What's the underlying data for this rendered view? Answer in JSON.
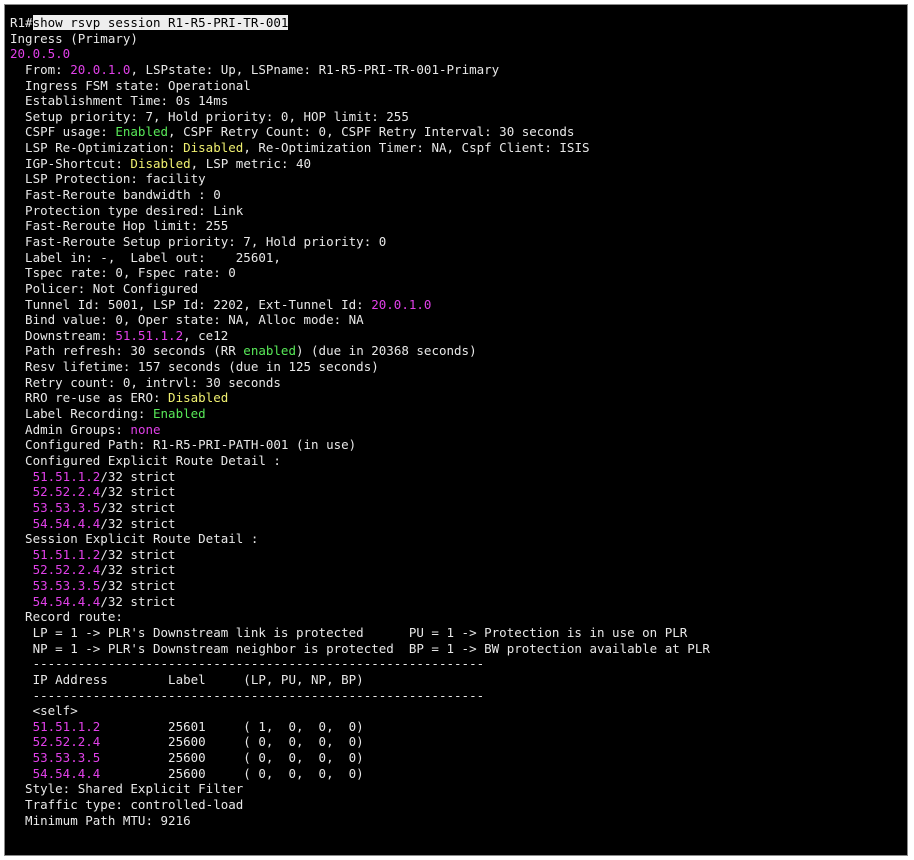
{
  "theme": {
    "background": "#000000",
    "default": "#e8e8e8",
    "magenta": "#e040e8",
    "green": "#58e858",
    "yellow": "#f0f070",
    "highlight_bg": "#eeeeee",
    "highlight_fg": "#000000"
  },
  "terminal": {
    "lines": [
      [
        {
          "t": "R1#",
          "c": "w"
        },
        {
          "t": "show rsvp session R1-R5-PRI-TR-001",
          "c": "cmd"
        }
      ],
      [
        {
          "t": "Ingress (Primary)",
          "c": "w"
        }
      ],
      [
        {
          "t": "20.0.5.0",
          "c": "m"
        }
      ],
      [
        {
          "t": "  From: ",
          "c": "w"
        },
        {
          "t": "20.0.1.0",
          "c": "m"
        },
        {
          "t": ", LSPstate: Up, LSPname: R1-R5-PRI-TR-001-Primary",
          "c": "w"
        }
      ],
      [
        {
          "t": "  Ingress FSM state: Operational",
          "c": "w"
        }
      ],
      [
        {
          "t": "  Establishment Time: 0s 14ms",
          "c": "w"
        }
      ],
      [
        {
          "t": "  Setup priority: 7, Hold priority: 0, HOP limit: 255",
          "c": "w"
        }
      ],
      [
        {
          "t": "  CSPF usage: ",
          "c": "w"
        },
        {
          "t": "Enabled",
          "c": "g"
        },
        {
          "t": ", CSPF Retry Count: 0, CSPF Retry Interval: 30 seconds",
          "c": "w"
        }
      ],
      [
        {
          "t": "  LSP Re-Optimization: ",
          "c": "w"
        },
        {
          "t": "Disabled",
          "c": "y"
        },
        {
          "t": ", Re-Optimization Timer: NA, Cspf Client: ISIS",
          "c": "w"
        }
      ],
      [
        {
          "t": "  IGP-Shortcut: ",
          "c": "w"
        },
        {
          "t": "Disabled",
          "c": "y"
        },
        {
          "t": ", LSP metric: 40",
          "c": "w"
        }
      ],
      [
        {
          "t": "  LSP Protection: facility",
          "c": "w"
        }
      ],
      [
        {
          "t": "  Fast-Reroute bandwidth : 0",
          "c": "w"
        }
      ],
      [
        {
          "t": "  Protection type desired: Link",
          "c": "w"
        }
      ],
      [
        {
          "t": "  Fast-Reroute Hop limit: 255",
          "c": "w"
        }
      ],
      [
        {
          "t": "  Fast-Reroute Setup priority: 7, Hold priority: 0",
          "c": "w"
        }
      ],
      [
        {
          "t": "  Label in: -,  Label out:    25601,",
          "c": "w"
        }
      ],
      [
        {
          "t": "  Tspec rate: 0, Fspec rate: 0",
          "c": "w"
        }
      ],
      [
        {
          "t": "  Policer: Not Configured",
          "c": "w"
        }
      ],
      [
        {
          "t": "  Tunnel Id: 5001, LSP Id: 2202, Ext-Tunnel Id: ",
          "c": "w"
        },
        {
          "t": "20.0.1.0",
          "c": "m"
        }
      ],
      [
        {
          "t": "  Bind value: 0, Oper state: NA, Alloc mode: NA",
          "c": "w"
        }
      ],
      [
        {
          "t": "  Downstream: ",
          "c": "w"
        },
        {
          "t": "51.51.1.2",
          "c": "m"
        },
        {
          "t": ", ce12",
          "c": "w"
        }
      ],
      [
        {
          "t": "  Path refresh: 30 seconds (RR ",
          "c": "w"
        },
        {
          "t": "enabled",
          "c": "g"
        },
        {
          "t": ") (due in 20368 seconds)",
          "c": "w"
        }
      ],
      [
        {
          "t": "  Resv lifetime: 157 seconds (due in 125 seconds)",
          "c": "w"
        }
      ],
      [
        {
          "t": "  Retry count: 0, intrvl: 30 seconds",
          "c": "w"
        }
      ],
      [
        {
          "t": "  RRO re-use as ERO: ",
          "c": "w"
        },
        {
          "t": "Disabled",
          "c": "y"
        }
      ],
      [
        {
          "t": "  Label Recording: ",
          "c": "w"
        },
        {
          "t": "Enabled",
          "c": "g"
        }
      ],
      [
        {
          "t": "  Admin Groups: ",
          "c": "w"
        },
        {
          "t": "none",
          "c": "m"
        }
      ],
      [
        {
          "t": "  Configured Path: R1-R5-PRI-PATH-001 (in use)",
          "c": "w"
        }
      ],
      [
        {
          "t": "  Configured Explicit Route Detail :",
          "c": "w"
        }
      ],
      [
        {
          "t": "   ",
          "c": "w"
        },
        {
          "t": "51.51.1.2",
          "c": "m"
        },
        {
          "t": "/32 strict",
          "c": "w"
        }
      ],
      [
        {
          "t": "   ",
          "c": "w"
        },
        {
          "t": "52.52.2.4",
          "c": "m"
        },
        {
          "t": "/32 strict",
          "c": "w"
        }
      ],
      [
        {
          "t": "   ",
          "c": "w"
        },
        {
          "t": "53.53.3.5",
          "c": "m"
        },
        {
          "t": "/32 strict",
          "c": "w"
        }
      ],
      [
        {
          "t": "   ",
          "c": "w"
        },
        {
          "t": "54.54.4.4",
          "c": "m"
        },
        {
          "t": "/32 strict",
          "c": "w"
        }
      ],
      [
        {
          "t": "  Session Explicit Route Detail :",
          "c": "w"
        }
      ],
      [
        {
          "t": "   ",
          "c": "w"
        },
        {
          "t": "51.51.1.2",
          "c": "m"
        },
        {
          "t": "/32 strict",
          "c": "w"
        }
      ],
      [
        {
          "t": "   ",
          "c": "w"
        },
        {
          "t": "52.52.2.4",
          "c": "m"
        },
        {
          "t": "/32 strict",
          "c": "w"
        }
      ],
      [
        {
          "t": "   ",
          "c": "w"
        },
        {
          "t": "53.53.3.5",
          "c": "m"
        },
        {
          "t": "/32 strict",
          "c": "w"
        }
      ],
      [
        {
          "t": "   ",
          "c": "w"
        },
        {
          "t": "54.54.4.4",
          "c": "m"
        },
        {
          "t": "/32 strict",
          "c": "w"
        }
      ],
      [
        {
          "t": "  Record route:",
          "c": "w"
        }
      ],
      [
        {
          "t": "   LP = 1 -> PLR's Downstream link is protected      PU = 1 -> Protection is in use on PLR",
          "c": "w"
        }
      ],
      [
        {
          "t": "   NP = 1 -> PLR's Downstream neighbor is protected  BP = 1 -> BW protection available at PLR",
          "c": "w"
        }
      ],
      [
        {
          "t": "   ------------------------------------------------------------",
          "c": "w"
        }
      ],
      [
        {
          "t": "   IP Address        Label     (LP, PU, NP, BP)",
          "c": "w"
        }
      ],
      [
        {
          "t": "   ------------------------------------------------------------",
          "c": "w"
        }
      ],
      [
        {
          "t": "   <self>",
          "c": "w"
        }
      ],
      [
        {
          "t": "   ",
          "c": "w"
        },
        {
          "t": "51.51.1.2",
          "c": "m"
        },
        {
          "t": "         25601     ( 1,  0,  0,  0)",
          "c": "w"
        }
      ],
      [
        {
          "t": "   ",
          "c": "w"
        },
        {
          "t": "52.52.2.4",
          "c": "m"
        },
        {
          "t": "         25600     ( 0,  0,  0,  0)",
          "c": "w"
        }
      ],
      [
        {
          "t": "   ",
          "c": "w"
        },
        {
          "t": "53.53.3.5",
          "c": "m"
        },
        {
          "t": "         25600     ( 0,  0,  0,  0)",
          "c": "w"
        }
      ],
      [
        {
          "t": "   ",
          "c": "w"
        },
        {
          "t": "54.54.4.4",
          "c": "m"
        },
        {
          "t": "         25600     ( 0,  0,  0,  0)",
          "c": "w"
        }
      ],
      [
        {
          "t": "  Style: Shared Explicit Filter",
          "c": "w"
        }
      ],
      [
        {
          "t": "  Traffic type: controlled-load",
          "c": "w"
        }
      ],
      [
        {
          "t": "  Minimum Path MTU: 9216",
          "c": "w"
        }
      ]
    ]
  }
}
